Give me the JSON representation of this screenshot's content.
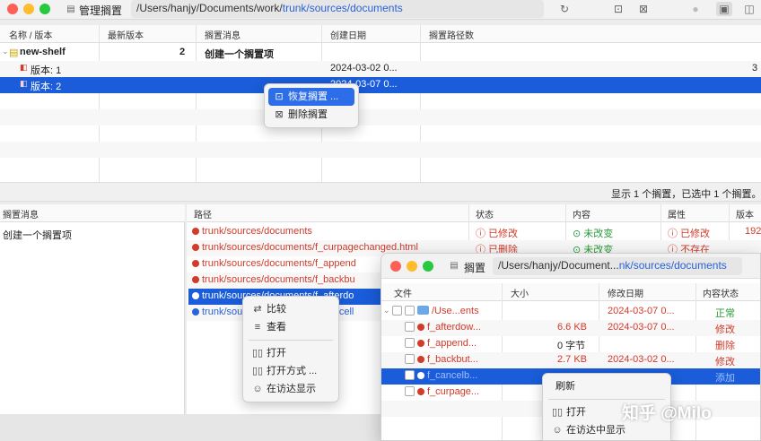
{
  "titlebar": {
    "title": "管理搁置",
    "path_prefix": "/Users/hanjy/Documents/work/",
    "path_link": "trunk/sources/documents"
  },
  "shelf_table": {
    "columns": [
      "名称 / 版本",
      "最新版本",
      "搁置消息",
      "创建日期",
      "搁置路径数"
    ],
    "rows": [
      {
        "name": "new-shelf",
        "latest": "2",
        "message": "创建一个搁置项",
        "date": "",
        "count": ""
      },
      {
        "name": "版本: 1",
        "latest": "",
        "message": "",
        "date": "2024-03-02 0...",
        "count": "3"
      },
      {
        "name": "版本: 2",
        "latest": "",
        "message": "",
        "date": "2024-03-07 0...",
        "count": ""
      }
    ]
  },
  "shelf_menu": {
    "items": [
      "恢复搁置 ...",
      "删除搁置"
    ]
  },
  "status_text": "显示 1 个搁置，已选中 1 个搁置。",
  "message_panel": {
    "header": "搁置消息",
    "text": "创建一个搁置项"
  },
  "paths_table": {
    "columns": [
      "路径",
      "状态",
      "内容",
      "属性",
      "版本"
    ],
    "rows": [
      {
        "path": "trunk/sources/documents",
        "status": "已修改",
        "content": "未改变",
        "prop": "已修改",
        "ver": "192"
      },
      {
        "path": "trunk/sources/documents/f_curpagechanged.html",
        "status": "已删除",
        "content": "未改变",
        "prop": "不存在",
        "ver": ""
      },
      {
        "path": "trunk/sources/documents/f_append",
        "status": "",
        "content": "",
        "prop": "",
        "ver": ""
      },
      {
        "path": "trunk/sources/documents/f_backbu",
        "status": "",
        "content": "",
        "prop": "",
        "ver": ""
      },
      {
        "path": "trunk/sources/documents/f_afterdo",
        "status": "",
        "content": "",
        "prop": "",
        "ver": ""
      },
      {
        "path": "trunk/sources/documents/f_cancell",
        "status": "",
        "content": "",
        "prop": "",
        "ver": ""
      }
    ]
  },
  "path_menu": {
    "items": [
      "比较",
      "查看",
      "打开",
      "打开方式 ...",
      "在访达显示"
    ]
  },
  "second_window": {
    "title": "搁置",
    "path_prefix": "/Users/hanjy/Document...",
    "path_link": "nk/sources/documents",
    "columns": [
      "文件",
      "大小",
      "修改日期",
      "内容状态"
    ],
    "rows": [
      {
        "name": "/Use...ents",
        "size": "",
        "date": "2024-03-07 0...",
        "status": "正常"
      },
      {
        "name": "f_afterdow...",
        "size": "6.6 KB",
        "date": "2024-03-07 0...",
        "status": "修改"
      },
      {
        "name": "f_append...",
        "size": "0 字节",
        "date": "",
        "status": "删除"
      },
      {
        "name": "f_backbut...",
        "size": "2.7 KB",
        "date": "2024-03-02 0...",
        "status": "修改"
      },
      {
        "name": "f_cancelb...",
        "size": "",
        "date": "",
        "status": "添加"
      },
      {
        "name": "f_curpage...",
        "size": "",
        "date": "",
        "status": ""
      }
    ]
  },
  "file_menu": {
    "items": [
      "刷新",
      "打开",
      "在访达中显示"
    ]
  },
  "watermark": "知乎 @Milo"
}
